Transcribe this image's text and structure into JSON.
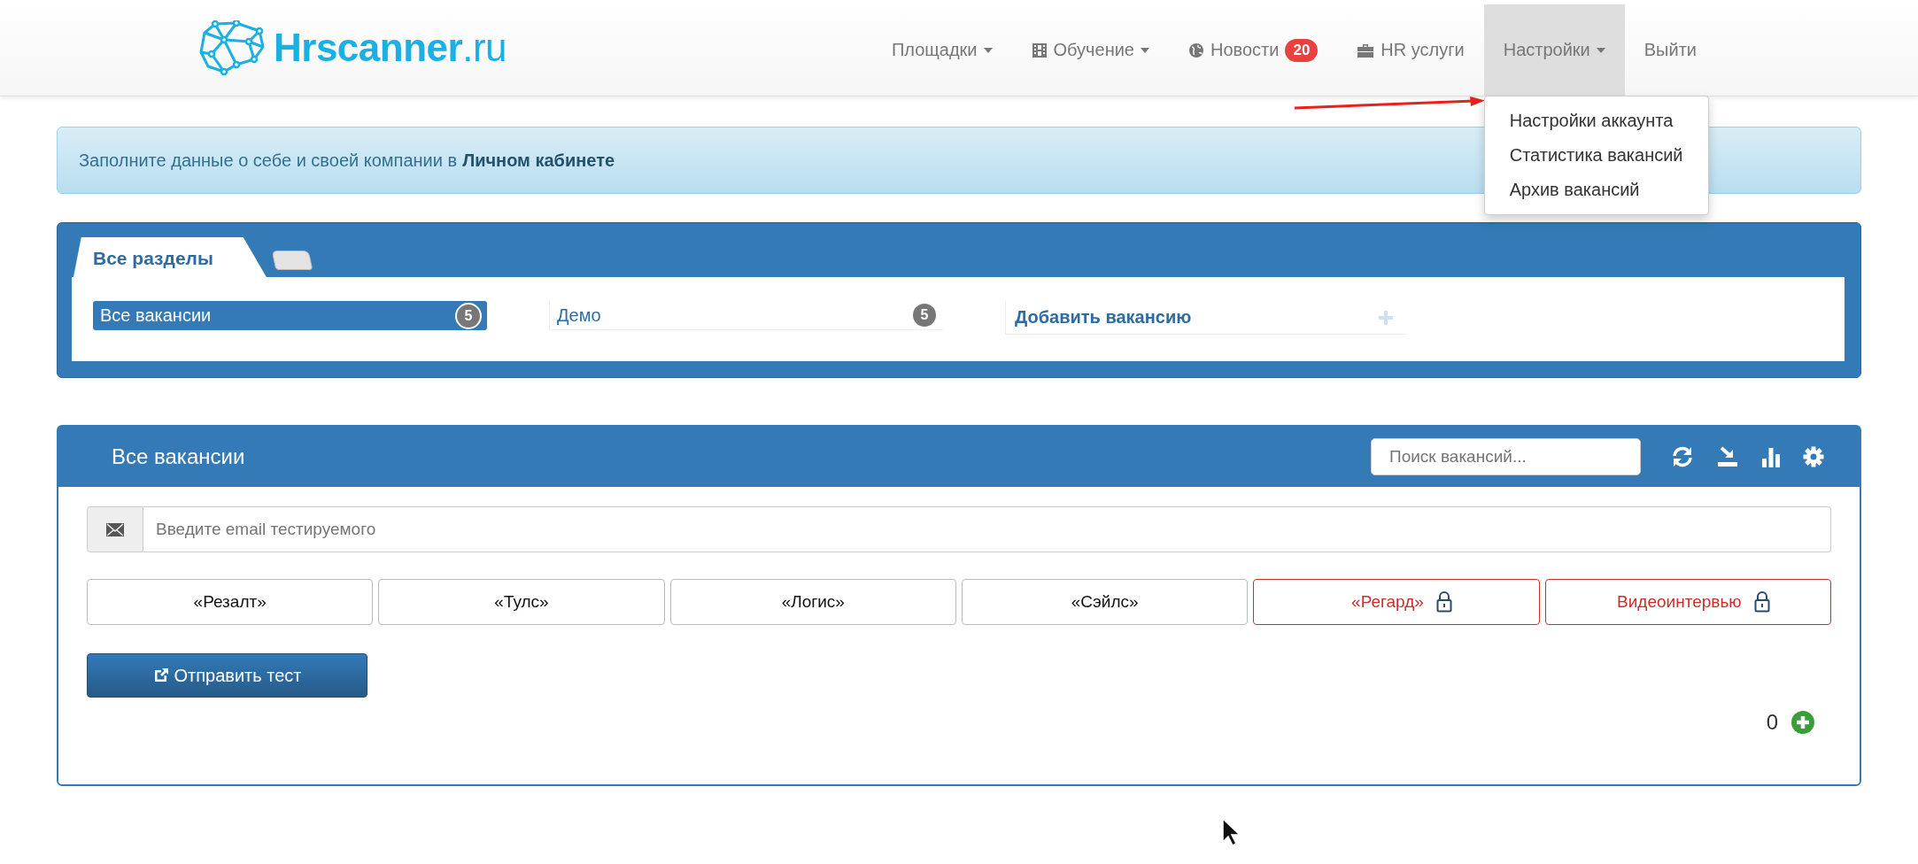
{
  "navbar": {
    "logo": {
      "name": "Hrscanner",
      "suffix": ".ru"
    },
    "items": [
      {
        "label": "Площадки",
        "kind": "dropdown",
        "expanded": false
      },
      {
        "label": "Обучение",
        "kind": "dropdown",
        "expanded": false
      },
      {
        "label": "Новости",
        "kind": "link",
        "badge": "20",
        "expanded": false
      },
      {
        "label": "HR услуги",
        "kind": "link",
        "expanded": false
      },
      {
        "label": "Настройки",
        "kind": "dropdown",
        "expanded": true,
        "menu": [
          "Настройки аккаунта",
          "Статистика вакансий",
          "Архив вакансий"
        ]
      },
      {
        "label": "Выйти",
        "kind": "link",
        "expanded": false
      }
    ]
  },
  "alert": {
    "text": "Заполните данные о себе и своей компании в",
    "link": "Личном кабинете"
  },
  "sections": {
    "tabs": [
      {
        "label": "Все разделы",
        "selected": true
      },
      {
        "selected": false
      }
    ],
    "items": [
      {
        "kind": "section",
        "label": "Все вакансии",
        "count": "5",
        "selected": true
      },
      {
        "kind": "section",
        "label": "Демо",
        "count": "5",
        "selected": false
      },
      {
        "kind": "add",
        "label": "Добавить вакансию"
      }
    ]
  },
  "vacancies": {
    "title": "Все вакансии",
    "search": {
      "placeholder": "Поиск вакансий..."
    },
    "email": {
      "placeholder": "Введите email тестируемого"
    },
    "tests": [
      {
        "label": "«Резалт»",
        "locked": false
      },
      {
        "label": "«Тулс»",
        "locked": false
      },
      {
        "label": "«Логис»",
        "locked": false
      },
      {
        "label": "«Сэйлс»",
        "locked": false
      },
      {
        "label": "«Регард»",
        "locked": true
      },
      {
        "label": "Видеоинтервью",
        "locked": true
      }
    ],
    "send_button": "Отправить тест",
    "counter": "0"
  }
}
